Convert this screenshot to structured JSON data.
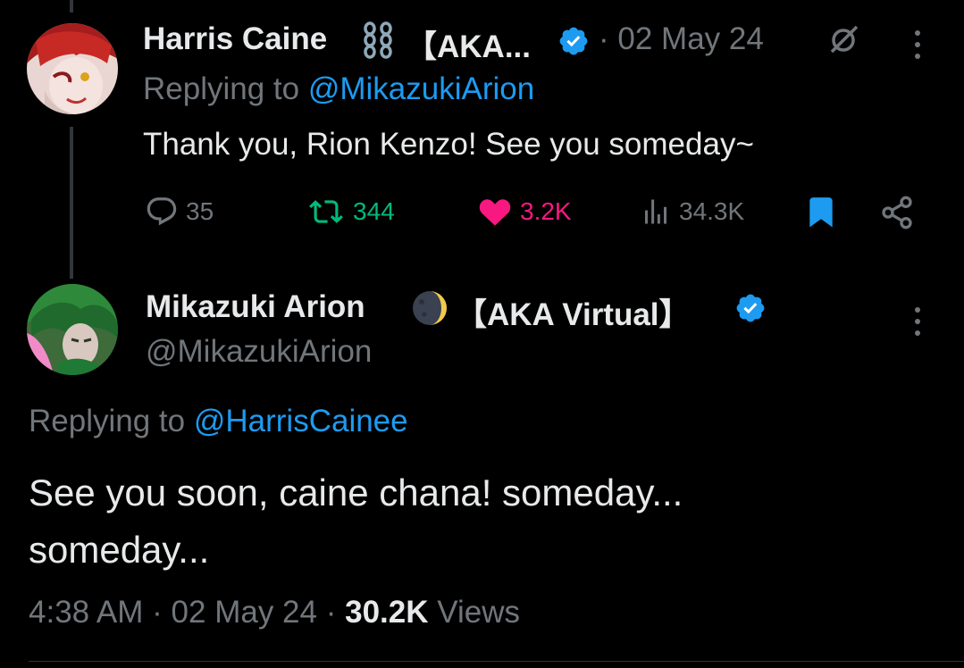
{
  "reply_tweet": {
    "display_name": "Harris Caine",
    "name_suffix": "【AKA...",
    "date": "02 May 24",
    "replying_prefix": "Replying to",
    "replying_handle": "@MikazukiArion",
    "text": "Thank you, Rion Kenzo! See you someday~",
    "stats": {
      "replies": "35",
      "retweets": "344",
      "likes": "3.2K",
      "views": "34.3K"
    },
    "colors": {
      "retweet": "#00ba7c",
      "like": "#f91880",
      "bookmark": "#1d9bf0"
    }
  },
  "main_tweet": {
    "display_name": "Mikazuki Arion",
    "name_suffix": "【AKA Virtual】",
    "handle": "@MikazukiArion",
    "replying_prefix": "Replying to",
    "replying_handle": "@HarrisCainee",
    "text_line1": "See you soon, caine chana! someday...",
    "text_line2": "someday...",
    "time": "4:38 AM",
    "date": "02 May 24",
    "views_count": "30.2K",
    "views_label": "Views"
  },
  "icons": [
    "chain-emoji-icon",
    "verified-badge-icon",
    "grok-icon",
    "more-icon",
    "reply-icon",
    "retweet-icon",
    "like-icon",
    "views-icon",
    "bookmark-icon",
    "share-icon",
    "moon-emoji-icon"
  ]
}
